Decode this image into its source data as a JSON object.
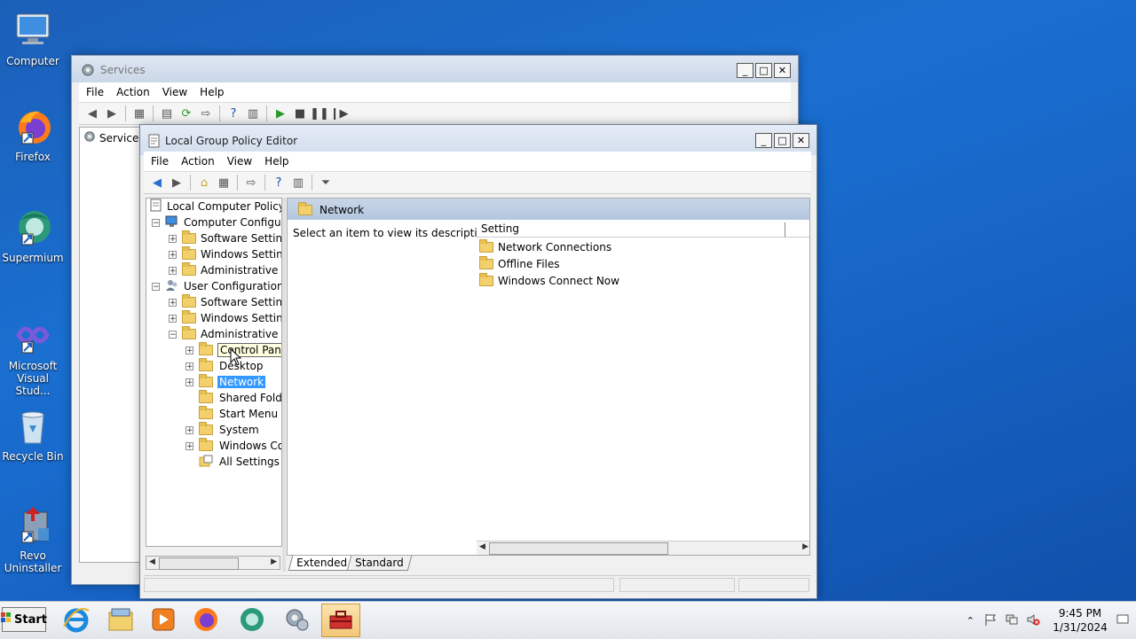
{
  "desktop": {
    "icons": [
      {
        "label": "Computer"
      },
      {
        "label": "Firefox"
      },
      {
        "label": "Supermium"
      },
      {
        "label_line1": "Microsoft",
        "label_line2": "Visual Stud..."
      },
      {
        "label": "Recycle Bin"
      },
      {
        "label_line1": "Revo",
        "label_line2": "Uninstaller"
      }
    ]
  },
  "services_window": {
    "title": "Services",
    "menu": [
      "File",
      "Action",
      "View",
      "Help"
    ],
    "tree_root": "Services"
  },
  "gpe_window": {
    "title": "Local Group Policy Editor",
    "menu": [
      "File",
      "Action",
      "View",
      "Help"
    ],
    "tree": {
      "root": "Local Computer Policy",
      "computer_config": "Computer Configura",
      "cc_software": "Software Settings",
      "cc_windows": "Windows Setting",
      "cc_admin": "Administrative Te",
      "user_config": "User Configuration",
      "uc_software": "Software Settings",
      "uc_windows": "Windows Setting",
      "uc_admin": "Administrative Te",
      "control_panel": "Control Panel",
      "desktop": "Desktop",
      "network": "Network",
      "shared_folders": "Shared Folder",
      "start_menu": "Start Menu ar",
      "system": "System",
      "windows_comp": "Windows Cor",
      "all_settings": "All Settings"
    },
    "right": {
      "header": "Network",
      "description": "Select an item to view its description.",
      "column_setting": "Setting",
      "items": [
        "Network Connections",
        "Offline Files",
        "Windows Connect Now"
      ]
    },
    "tabs": {
      "extended": "Extended",
      "standard": "Standard"
    }
  },
  "taskbar": {
    "start_label": "Start",
    "clock_time": "9:45 PM",
    "clock_date": "1/31/2024"
  },
  "colors": {
    "selection": "#3399ff",
    "desktop": "#1a6fd0"
  }
}
